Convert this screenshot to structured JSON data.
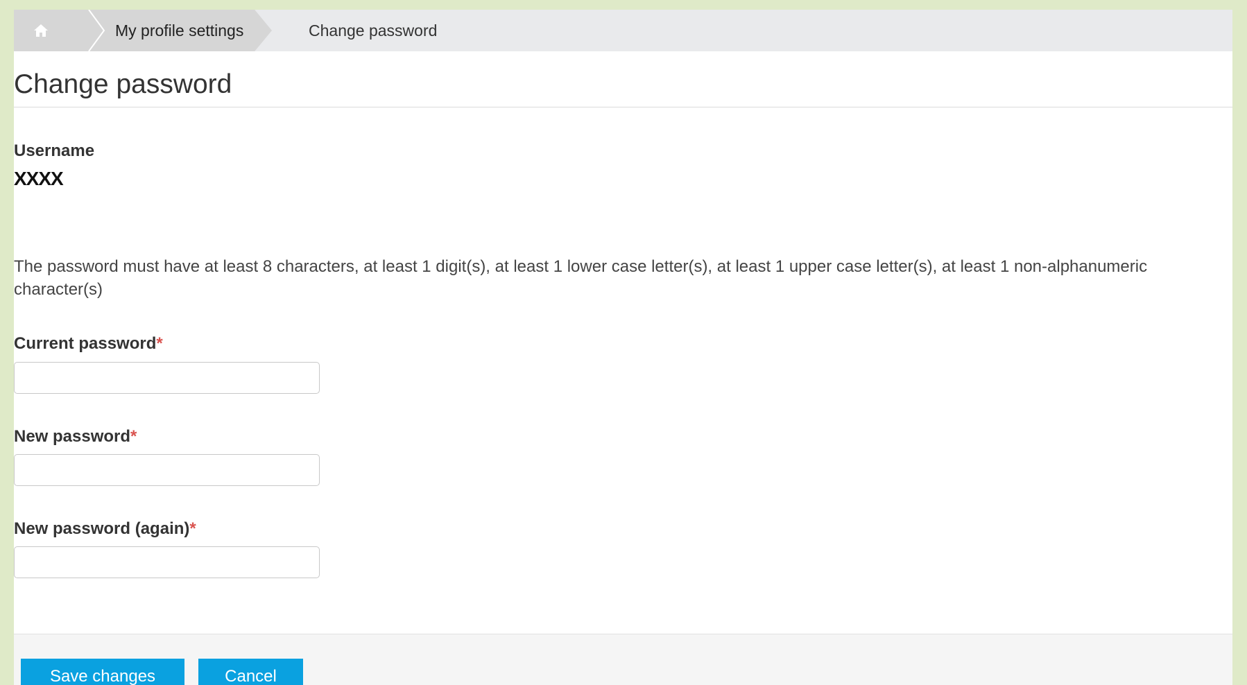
{
  "breadcrumb": {
    "home_icon": "home-icon",
    "profile_label": "My profile settings",
    "current_label": "Change password"
  },
  "page": {
    "title": "Change password"
  },
  "username": {
    "label": "Username",
    "value": "XXXX"
  },
  "rules": {
    "text": "The password must have at least 8 characters, at least 1 digit(s), at least 1 lower case letter(s), at least 1 upper case letter(s), at least 1 non-alphanumeric character(s)"
  },
  "fields": {
    "current": {
      "label": "Current password",
      "required_mark": "*",
      "value": ""
    },
    "new": {
      "label": "New password",
      "required_mark": "*",
      "value": ""
    },
    "confirm": {
      "label": "New password (again)",
      "required_mark": "*",
      "value": ""
    }
  },
  "actions": {
    "save_label": "Save changes",
    "cancel_label": "Cancel"
  },
  "colors": {
    "accent": "#0aa1e0",
    "required": "#d9534f",
    "background": "#dfeac8"
  }
}
